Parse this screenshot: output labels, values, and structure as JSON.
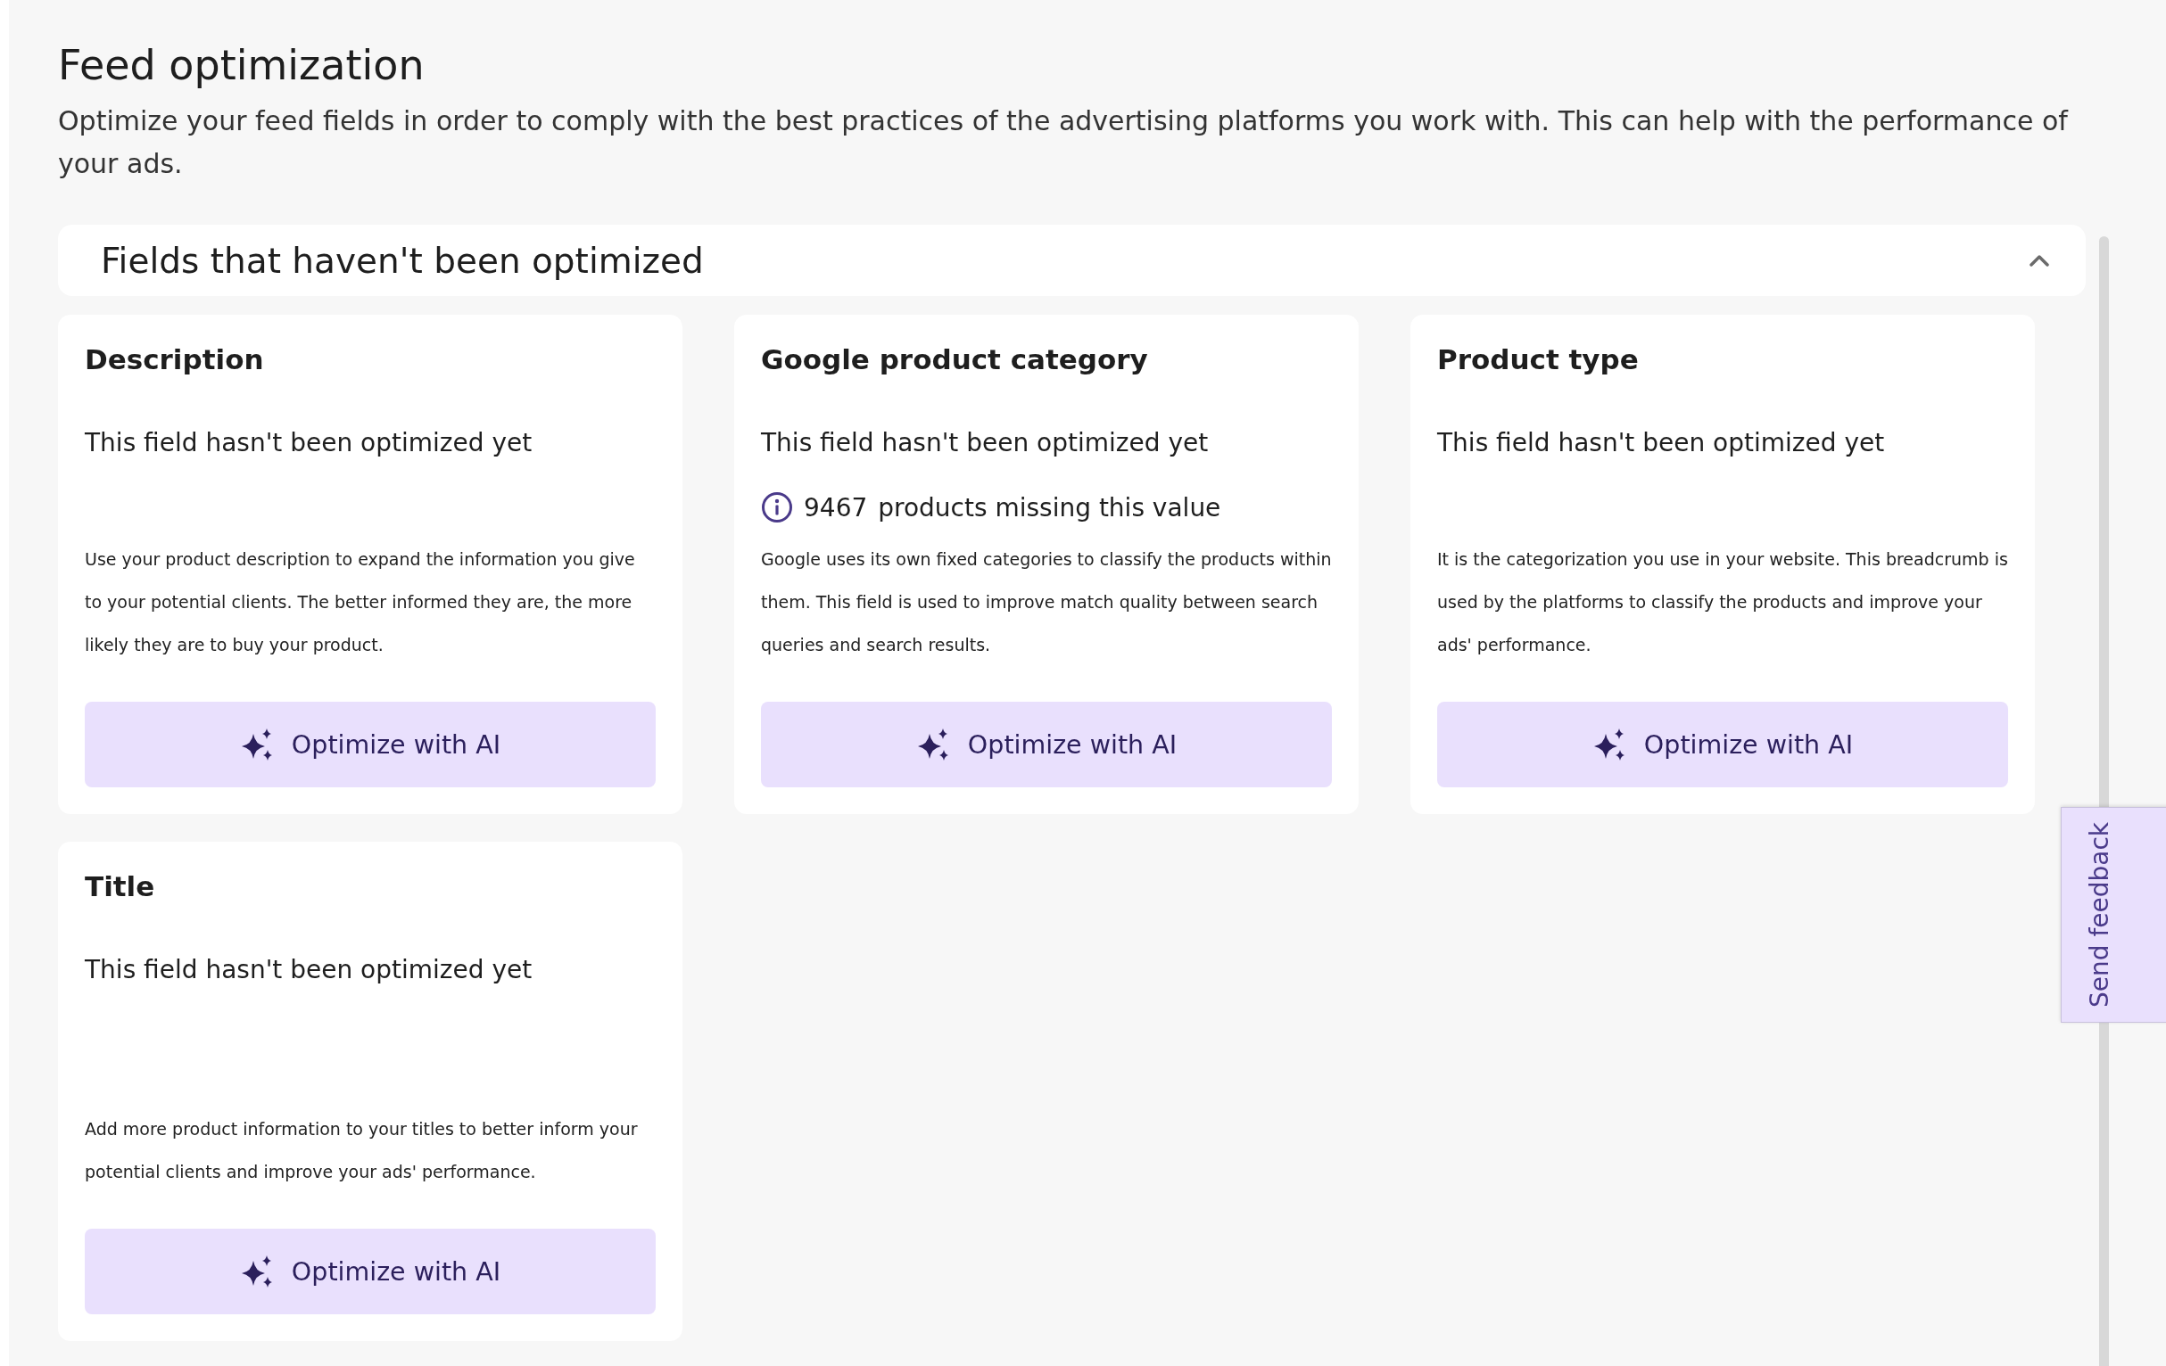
{
  "page": {
    "title": "Feed optimization",
    "description": "Optimize your feed fields in order to comply with the best practices of the advertising platforms you work with. This can help with the performance of your ads."
  },
  "section": {
    "title": "Fields that haven't been optimized",
    "expanded": true
  },
  "cards": [
    {
      "title": "Description",
      "status": "This field hasn't been optimized yet",
      "body": "Use your product description to expand the information you give to your potential clients. The better informed they are, the more likely they are to buy your product.",
      "button": "Optimize with AI"
    },
    {
      "title": "Google product category",
      "status": "This field hasn't been optimized yet",
      "missing": {
        "count": "9467",
        "label": "products missing this value"
      },
      "body": "Google uses its own fixed categories to classify the products within them. This field is used to improve match quality between search queries and search results.",
      "button": "Optimize with AI"
    },
    {
      "title": "Product type",
      "status": "This field hasn't been optimized yet",
      "body": "It is the categorization you use in your website. This breadcrumb is used by the platforms to classify the products and improve your ads' performance.",
      "button": "Optimize with AI"
    },
    {
      "title": "Title",
      "status": "This field hasn't been optimized yet",
      "body": "Add more product information to your titles to better inform your potential clients and improve your ads' performance.",
      "button": "Optimize with AI"
    }
  ],
  "feedback_tab": {
    "label": "Send feedback"
  }
}
